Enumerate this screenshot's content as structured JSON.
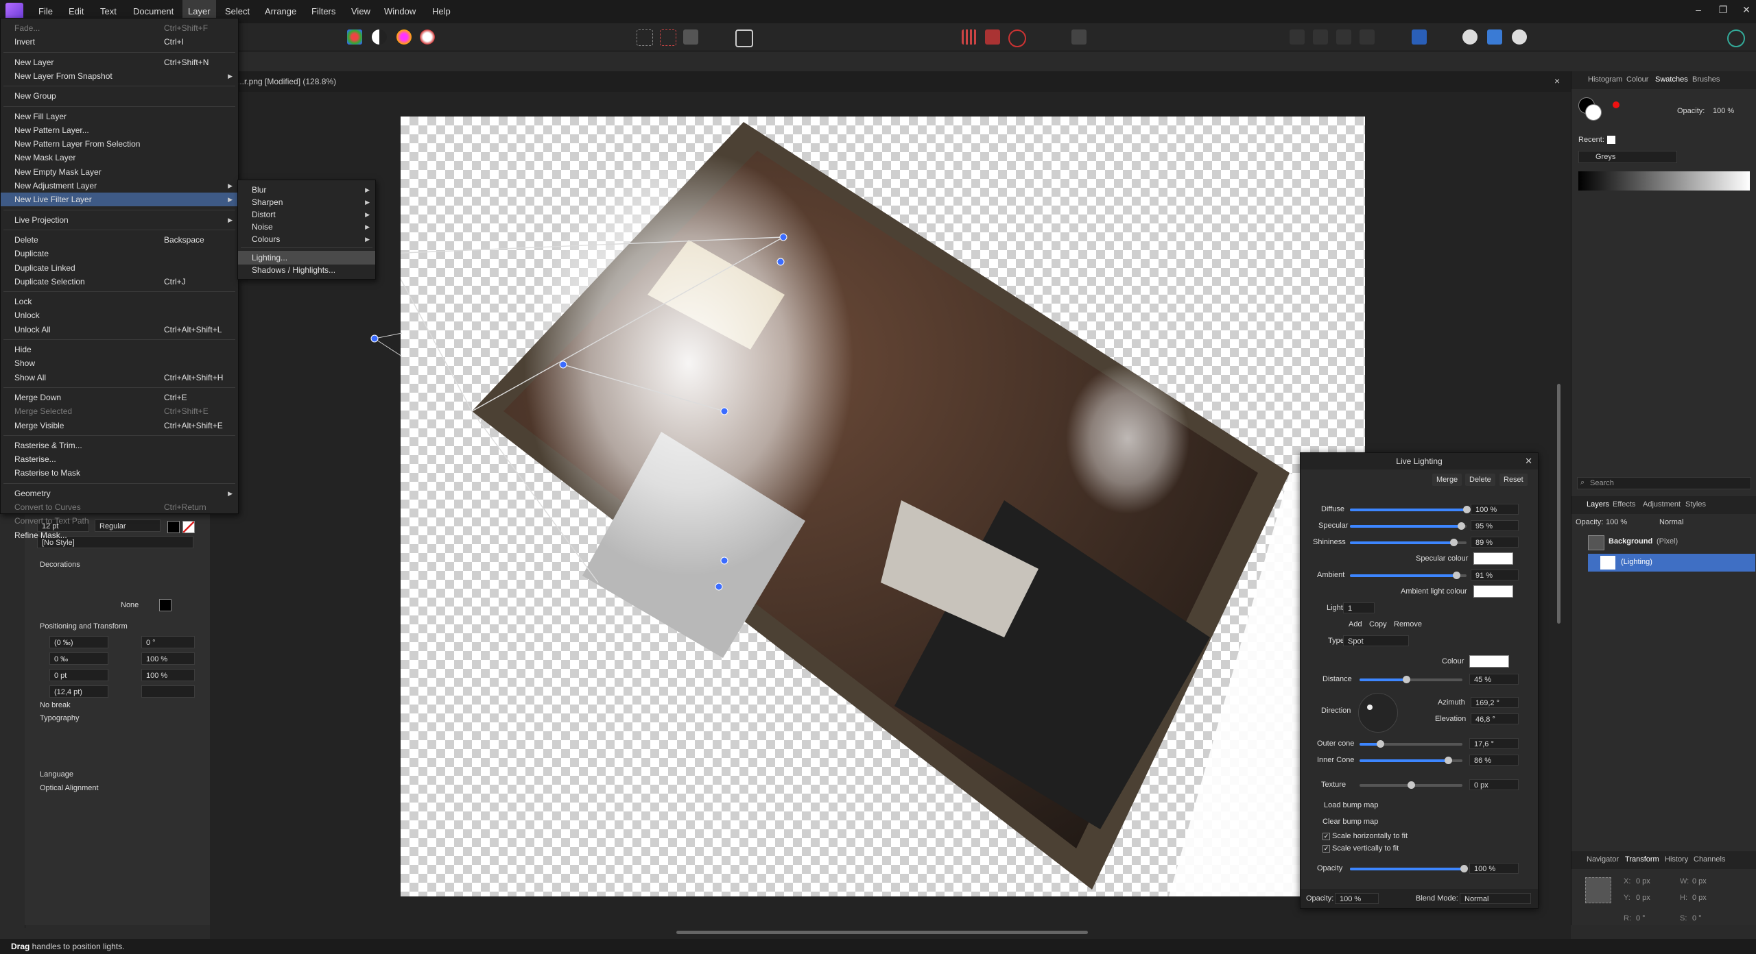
{
  "menubar": {
    "items": [
      "File",
      "Edit",
      "Text",
      "Document",
      "Layer",
      "Select",
      "Arrange",
      "Filters",
      "View",
      "Window",
      "Help"
    ],
    "window_controls": [
      "–",
      "❐",
      "✕"
    ]
  },
  "document": {
    "title": "...r.png [Modified] (128.8%)",
    "close": "×"
  },
  "layer_menu": {
    "items": [
      {
        "label": "Fade...",
        "shortcut": "Ctrl+Shift+F",
        "disabled": true
      },
      {
        "label": "Invert",
        "shortcut": "Ctrl+I"
      },
      {
        "label": "New Layer",
        "shortcut": "Ctrl+Shift+N"
      },
      {
        "label": "New Layer From Snapshot",
        "submenu": true
      },
      {
        "label": "New Group"
      },
      {
        "label": "New Fill Layer"
      },
      {
        "label": "New Pattern Layer..."
      },
      {
        "label": "New Pattern Layer From Selection"
      },
      {
        "label": "New Mask Layer"
      },
      {
        "label": "New Empty Mask Layer"
      },
      {
        "label": "New Adjustment Layer",
        "submenu": true
      },
      {
        "label": "New Live Filter Layer",
        "submenu": true,
        "highlighted": true
      },
      {
        "label": "Live Projection",
        "submenu": true
      },
      {
        "label": "Delete",
        "shortcut": "Backspace"
      },
      {
        "label": "Duplicate"
      },
      {
        "label": "Duplicate Linked"
      },
      {
        "label": "Duplicate Selection",
        "shortcut": "Ctrl+J"
      },
      {
        "label": "Lock"
      },
      {
        "label": "Unlock"
      },
      {
        "label": "Unlock All",
        "shortcut": "Ctrl+Alt+Shift+L"
      },
      {
        "label": "Hide"
      },
      {
        "label": "Show"
      },
      {
        "label": "Show All",
        "shortcut": "Ctrl+Alt+Shift+H"
      },
      {
        "label": "Merge Down",
        "shortcut": "Ctrl+E"
      },
      {
        "label": "Merge Selected",
        "shortcut": "Ctrl+Shift+E",
        "disabled": true
      },
      {
        "label": "Merge Visible",
        "shortcut": "Ctrl+Alt+Shift+E"
      },
      {
        "label": "Rasterise & Trim..."
      },
      {
        "label": "Rasterise..."
      },
      {
        "label": "Rasterise to Mask"
      },
      {
        "label": "Geometry",
        "submenu": true
      },
      {
        "label": "Convert to Curves",
        "shortcut": "Ctrl+Return",
        "disabled": true
      },
      {
        "label": "Convert to Text Path",
        "disabled": true
      },
      {
        "label": "Refine Mask..."
      }
    ]
  },
  "filter_submenu": {
    "items": [
      {
        "label": "Blur",
        "submenu": true
      },
      {
        "label": "Sharpen",
        "submenu": true
      },
      {
        "label": "Distort",
        "submenu": true
      },
      {
        "label": "Noise",
        "submenu": true
      },
      {
        "label": "Colours",
        "submenu": true
      },
      {
        "label": "Lighting...",
        "highlighted": true
      },
      {
        "label": "Shadows / Highlights..."
      }
    ]
  },
  "left_panel": {
    "font_size": "12 pt",
    "font_weight": "Regular",
    "style": "[No Style]",
    "decorations_header": "Decorations",
    "decoration_none": "None",
    "positioning_header": "Positioning and Transform",
    "fields": [
      "(0 ‰)",
      "0 °",
      "0 ‰",
      "100 %",
      "0 pt",
      "100 %",
      "(12,4 pt)",
      ""
    ],
    "no_break": "No break",
    "typography": "Typography",
    "language": "Language",
    "optical_alignment": "Optical Alignment"
  },
  "right_panel": {
    "top_tabs": [
      "Histogram",
      "Colour",
      "Swatches",
      "Brushes"
    ],
    "opacity_label": "Opacity:",
    "opacity_value": "100 %",
    "recent_label": "Recent:",
    "palette": "Greys",
    "search_placeholder": "Search",
    "layer_tabs": [
      "Layers",
      "Effects",
      "Adjustment",
      "Styles"
    ],
    "layer_opacity_label": "Opacity:",
    "layer_opacity": "100 %",
    "blend_mode": "Normal",
    "layers": [
      {
        "name": "Background",
        "type": "(Pixel)"
      },
      {
        "name": "(Lighting)",
        "selected": true
      }
    ],
    "bottom_tabs": [
      "Navigator",
      "Transform",
      "History",
      "Channels"
    ],
    "transform_fields": [
      "X:",
      "0 px",
      "W:",
      "0 px",
      "Y:",
      "0 px",
      "H:",
      "0 px",
      "R:",
      "0 °",
      "S:",
      "0 °"
    ]
  },
  "live_lighting": {
    "title": "Live Lighting",
    "buttons": [
      "Merge",
      "Delete",
      "Reset"
    ],
    "diffuse": {
      "label": "Diffuse",
      "value": "100 %",
      "fraction": 1.0
    },
    "specular": {
      "label": "Specular",
      "value": "95 %",
      "fraction": 0.95
    },
    "shininess": {
      "label": "Shininess",
      "value": "89 %",
      "fraction": 0.89
    },
    "specular_colour": "Specular colour",
    "ambient": {
      "label": "Ambient",
      "value": "91 %",
      "fraction": 0.91
    },
    "ambient_light_colour": "Ambient light colour",
    "light_label": "Light",
    "light_value": "1",
    "light_actions": [
      "Add",
      "Copy",
      "Remove"
    ],
    "type_label": "Type",
    "type_value": "Spot",
    "colour_label": "Colour",
    "distance": {
      "label": "Distance",
      "value": "45 %",
      "fraction": 0.45
    },
    "direction_label": "Direction",
    "azimuth_label": "Azimuth",
    "azimuth_value": "169,2 °",
    "elevation_label": "Elevation",
    "elevation_value": "46,8 °",
    "outer_cone": {
      "label": "Outer cone",
      "value": "17,6 °",
      "fraction": 0.2
    },
    "inner_cone": {
      "label": "Inner Cone",
      "value": "86 %",
      "fraction": 0.86
    },
    "texture": {
      "label": "Texture",
      "value": "0 px",
      "fraction": 0.5
    },
    "load_bump": "Load bump map",
    "clear_bump": "Clear bump map",
    "scale_h": "Scale horizontally to fit",
    "scale_v": "Scale vertically to fit",
    "opacity": {
      "label": "Opacity",
      "value": "100 %",
      "fraction": 1.0
    },
    "footer_opacity_label": "Opacity:",
    "footer_opacity": "100 %",
    "footer_blend_label": "Blend Mode:",
    "footer_blend": "Normal"
  },
  "status": {
    "bold": "Drag",
    "text": " handles to position lights."
  }
}
